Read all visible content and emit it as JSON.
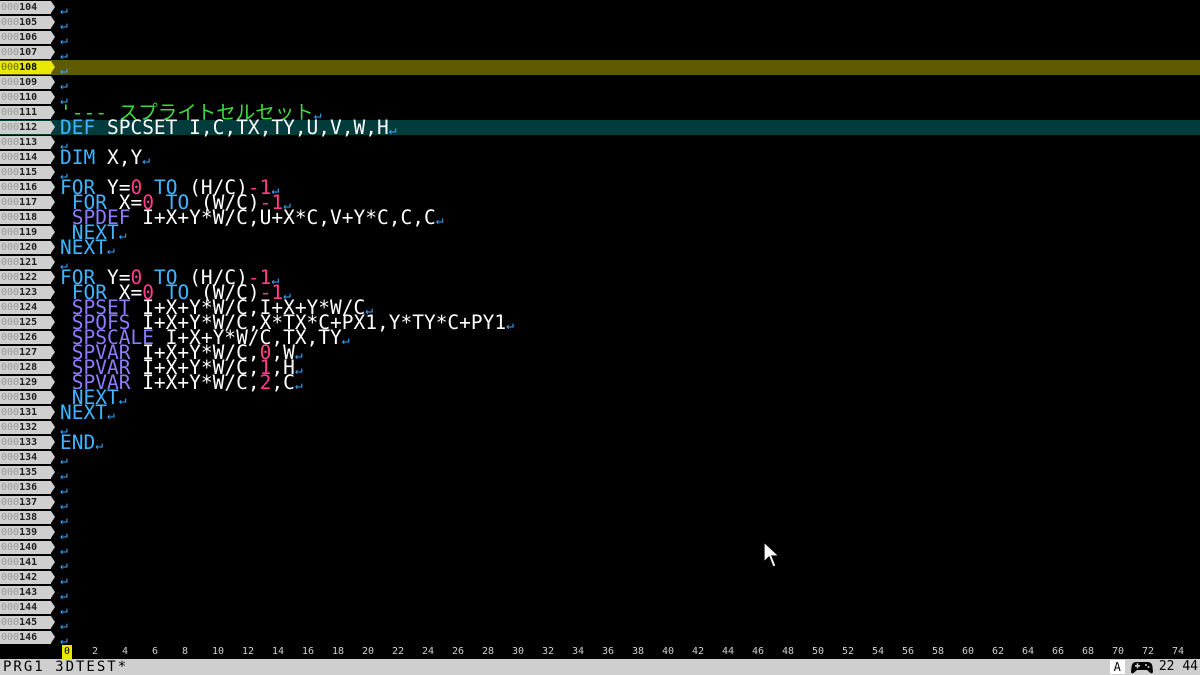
{
  "editor": {
    "lines": [
      {
        "num": "000104",
        "segments": []
      },
      {
        "num": "000105",
        "segments": []
      },
      {
        "num": "000106",
        "segments": []
      },
      {
        "num": "000107",
        "segments": []
      },
      {
        "num": "000108",
        "current": true,
        "segments": []
      },
      {
        "num": "000109",
        "segments": []
      },
      {
        "num": "000110",
        "segments": []
      },
      {
        "num": "000111",
        "segments": [
          {
            "t": "'--- スプライトセルセット",
            "c": "cm"
          }
        ]
      },
      {
        "num": "000112",
        "cursor": true,
        "segments": [
          {
            "t": "DEF",
            "c": "kw"
          },
          {
            "t": " SPCSET I,C,TX,TY,U,V,W,H",
            "c": "tx"
          }
        ]
      },
      {
        "num": "000113",
        "segments": []
      },
      {
        "num": "000114",
        "segments": [
          {
            "t": "DIM",
            "c": "kw"
          },
          {
            "t": " X,Y",
            "c": "tx"
          }
        ]
      },
      {
        "num": "000115",
        "segments": []
      },
      {
        "num": "000116",
        "segments": [
          {
            "t": "FOR",
            "c": "kw"
          },
          {
            "t": " Y=",
            "c": "tx"
          },
          {
            "t": "0",
            "c": "num"
          },
          {
            "t": " ",
            "c": "tx"
          },
          {
            "t": "TO",
            "c": "kw"
          },
          {
            "t": " (H/C)",
            "c": "tx"
          },
          {
            "t": "-1",
            "c": "num"
          }
        ]
      },
      {
        "num": "000117",
        "segments": [
          {
            "t": " ",
            "c": "tx"
          },
          {
            "t": "FOR",
            "c": "kw"
          },
          {
            "t": " X=",
            "c": "tx"
          },
          {
            "t": "0",
            "c": "num"
          },
          {
            "t": " ",
            "c": "tx"
          },
          {
            "t": "TO",
            "c": "kw"
          },
          {
            "t": " (W/C)",
            "c": "tx"
          },
          {
            "t": "-1",
            "c": "num"
          }
        ]
      },
      {
        "num": "000118",
        "segments": [
          {
            "t": " ",
            "c": "tx"
          },
          {
            "t": "SPDEF",
            "c": "fn"
          },
          {
            "t": " I+X+Y*W/C,U+X*C,V+Y*C,C,C",
            "c": "tx"
          }
        ]
      },
      {
        "num": "000119",
        "segments": [
          {
            "t": " ",
            "c": "tx"
          },
          {
            "t": "NEXT",
            "c": "kw"
          }
        ]
      },
      {
        "num": "000120",
        "segments": [
          {
            "t": "NEXT",
            "c": "kw"
          }
        ]
      },
      {
        "num": "000121",
        "segments": []
      },
      {
        "num": "000122",
        "segments": [
          {
            "t": "FOR",
            "c": "kw"
          },
          {
            "t": " Y=",
            "c": "tx"
          },
          {
            "t": "0",
            "c": "num"
          },
          {
            "t": " ",
            "c": "tx"
          },
          {
            "t": "TO",
            "c": "kw"
          },
          {
            "t": " (H/C)",
            "c": "tx"
          },
          {
            "t": "-1",
            "c": "num"
          }
        ]
      },
      {
        "num": "000123",
        "segments": [
          {
            "t": " ",
            "c": "tx"
          },
          {
            "t": "FOR",
            "c": "kw"
          },
          {
            "t": " X=",
            "c": "tx"
          },
          {
            "t": "0",
            "c": "num"
          },
          {
            "t": " ",
            "c": "tx"
          },
          {
            "t": "TO",
            "c": "kw"
          },
          {
            "t": " (W/C)",
            "c": "tx"
          },
          {
            "t": "-1",
            "c": "num"
          }
        ]
      },
      {
        "num": "000124",
        "segments": [
          {
            "t": " ",
            "c": "tx"
          },
          {
            "t": "SPSET",
            "c": "fn"
          },
          {
            "t": " I+X+Y*W/C,I+X+Y*W/C",
            "c": "tx"
          }
        ]
      },
      {
        "num": "000125",
        "segments": [
          {
            "t": " ",
            "c": "tx"
          },
          {
            "t": "SPOFS",
            "c": "fn"
          },
          {
            "t": " I+X+Y*W/C,X*TX*C+PX1,Y*TY*C+PY1",
            "c": "tx"
          }
        ]
      },
      {
        "num": "000126",
        "segments": [
          {
            "t": " ",
            "c": "tx"
          },
          {
            "t": "SPSCALE",
            "c": "fn"
          },
          {
            "t": " I+X+Y*W/C,TX,TY",
            "c": "tx"
          }
        ]
      },
      {
        "num": "000127",
        "segments": [
          {
            "t": " ",
            "c": "tx"
          },
          {
            "t": "SPVAR",
            "c": "fn"
          },
          {
            "t": " I+X+Y*W/C,",
            "c": "tx"
          },
          {
            "t": "0",
            "c": "num"
          },
          {
            "t": ",W",
            "c": "tx"
          }
        ]
      },
      {
        "num": "000128",
        "segments": [
          {
            "t": " ",
            "c": "tx"
          },
          {
            "t": "SPVAR",
            "c": "fn"
          },
          {
            "t": " I+X+Y*W/C,",
            "c": "tx"
          },
          {
            "t": "1",
            "c": "num"
          },
          {
            "t": ",H",
            "c": "tx"
          }
        ]
      },
      {
        "num": "000129",
        "segments": [
          {
            "t": " ",
            "c": "tx"
          },
          {
            "t": "SPVAR",
            "c": "fn"
          },
          {
            "t": " I+X+Y*W/C,",
            "c": "tx"
          },
          {
            "t": "2",
            "c": "num"
          },
          {
            "t": ",C",
            "c": "tx"
          }
        ]
      },
      {
        "num": "000130",
        "segments": [
          {
            "t": " ",
            "c": "tx"
          },
          {
            "t": "NEXT",
            "c": "kw"
          }
        ]
      },
      {
        "num": "000131",
        "segments": [
          {
            "t": "NEXT",
            "c": "kw"
          }
        ]
      },
      {
        "num": "000132",
        "segments": []
      },
      {
        "num": "000133",
        "segments": [
          {
            "t": "END",
            "c": "kw"
          }
        ]
      },
      {
        "num": "000134",
        "segments": []
      },
      {
        "num": "000135",
        "segments": []
      },
      {
        "num": "000136",
        "segments": []
      },
      {
        "num": "000137",
        "segments": []
      },
      {
        "num": "000138",
        "segments": []
      },
      {
        "num": "000139",
        "segments": []
      },
      {
        "num": "000140",
        "segments": []
      },
      {
        "num": "000141",
        "segments": []
      },
      {
        "num": "000142",
        "segments": []
      },
      {
        "num": "000143",
        "segments": []
      },
      {
        "num": "000144",
        "segments": []
      },
      {
        "num": "000145",
        "segments": []
      },
      {
        "num": "000146",
        "segments": []
      }
    ],
    "newline_glyph": "↵",
    "colors": {
      "keyword": "#3fb4ff",
      "function": "#8a7cff",
      "number": "#ff3d8b",
      "comment": "#3ddc3d",
      "current_line": "#5e5a00",
      "cursor_line": "#003c3c"
    }
  },
  "ruler": {
    "ticks": [
      "0",
      "2",
      "4",
      "6",
      "8",
      "10",
      "12",
      "14",
      "16",
      "18",
      "20",
      "22",
      "24",
      "26",
      "28",
      "30",
      "32",
      "34",
      "36",
      "38",
      "40",
      "42",
      "44",
      "46",
      "48",
      "50",
      "52",
      "54",
      "56",
      "58",
      "60",
      "62",
      "64",
      "66",
      "68",
      "70",
      "72",
      "74"
    ],
    "active": "0"
  },
  "status": {
    "file": "PRG1 3DTEST*",
    "mode": "A",
    "controller_icon": "gamepad-icon",
    "clock": "22 44"
  }
}
